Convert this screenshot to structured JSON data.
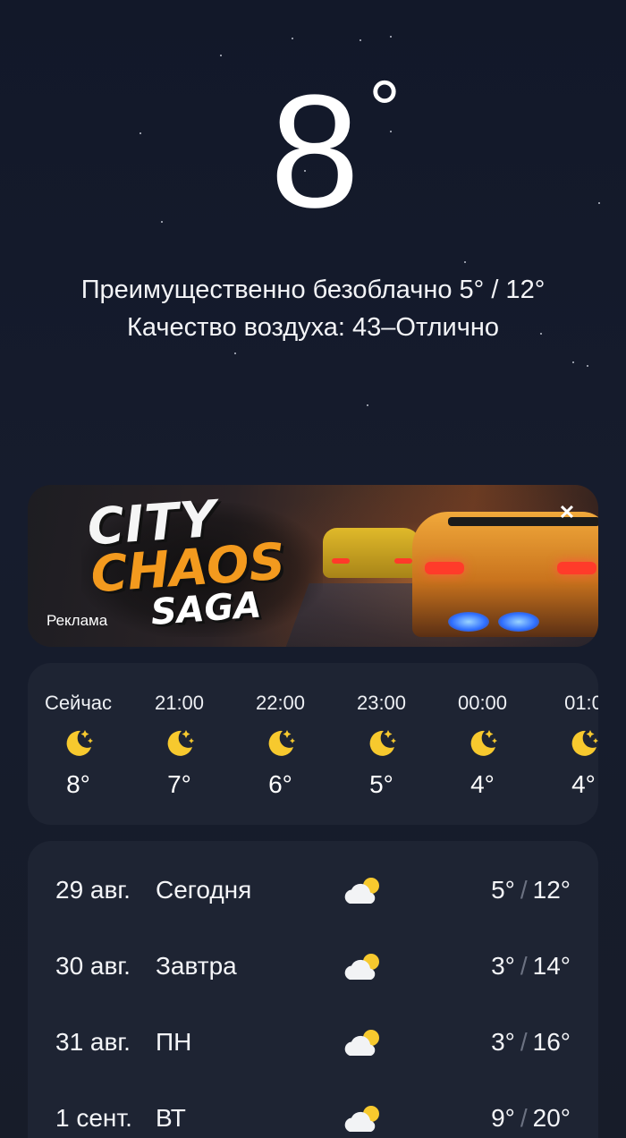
{
  "current": {
    "temperature": "8",
    "degree_symbol": "°",
    "summary": "Преимущественно безоблачно  5° / 12°",
    "air_quality": "Качество воздуха: 43–Отлично"
  },
  "ad": {
    "title_line1": "CITY",
    "title_line2": "CHAOS",
    "title_line3": "SAGA",
    "label": "Реклама",
    "close_glyph": "✕"
  },
  "hourly": [
    {
      "time": "Сейчас",
      "temp": "8°",
      "icon": "moon-stars-icon"
    },
    {
      "time": "21:00",
      "temp": "7°",
      "icon": "moon-stars-icon"
    },
    {
      "time": "22:00",
      "temp": "6°",
      "icon": "moon-stars-icon"
    },
    {
      "time": "23:00",
      "temp": "5°",
      "icon": "moon-stars-icon"
    },
    {
      "time": "00:00",
      "temp": "4°",
      "icon": "moon-stars-icon"
    },
    {
      "time": "01:0",
      "temp": "4°",
      "icon": "moon-stars-icon"
    }
  ],
  "daily": [
    {
      "date": "29 авг.",
      "name": "Сегодня",
      "low": "5°",
      "high": "12°",
      "icon": "partly-cloudy-icon"
    },
    {
      "date": "30 авг.",
      "name": "Завтра",
      "low": "3°",
      "high": "14°",
      "icon": "partly-cloudy-icon"
    },
    {
      "date": "31 авг.",
      "name": "ПН",
      "low": "3°",
      "high": "16°",
      "icon": "partly-cloudy-icon"
    },
    {
      "date": "1 сент.",
      "name": "ВТ",
      "low": "9°",
      "high": "20°",
      "icon": "partly-cloudy-icon"
    }
  ],
  "temp_separator": "/",
  "colors": {
    "background": "#141a2a",
    "card": "#1e2433",
    "icon_yellow": "#f7c92e",
    "cloud_white": "#f2f3f5"
  }
}
